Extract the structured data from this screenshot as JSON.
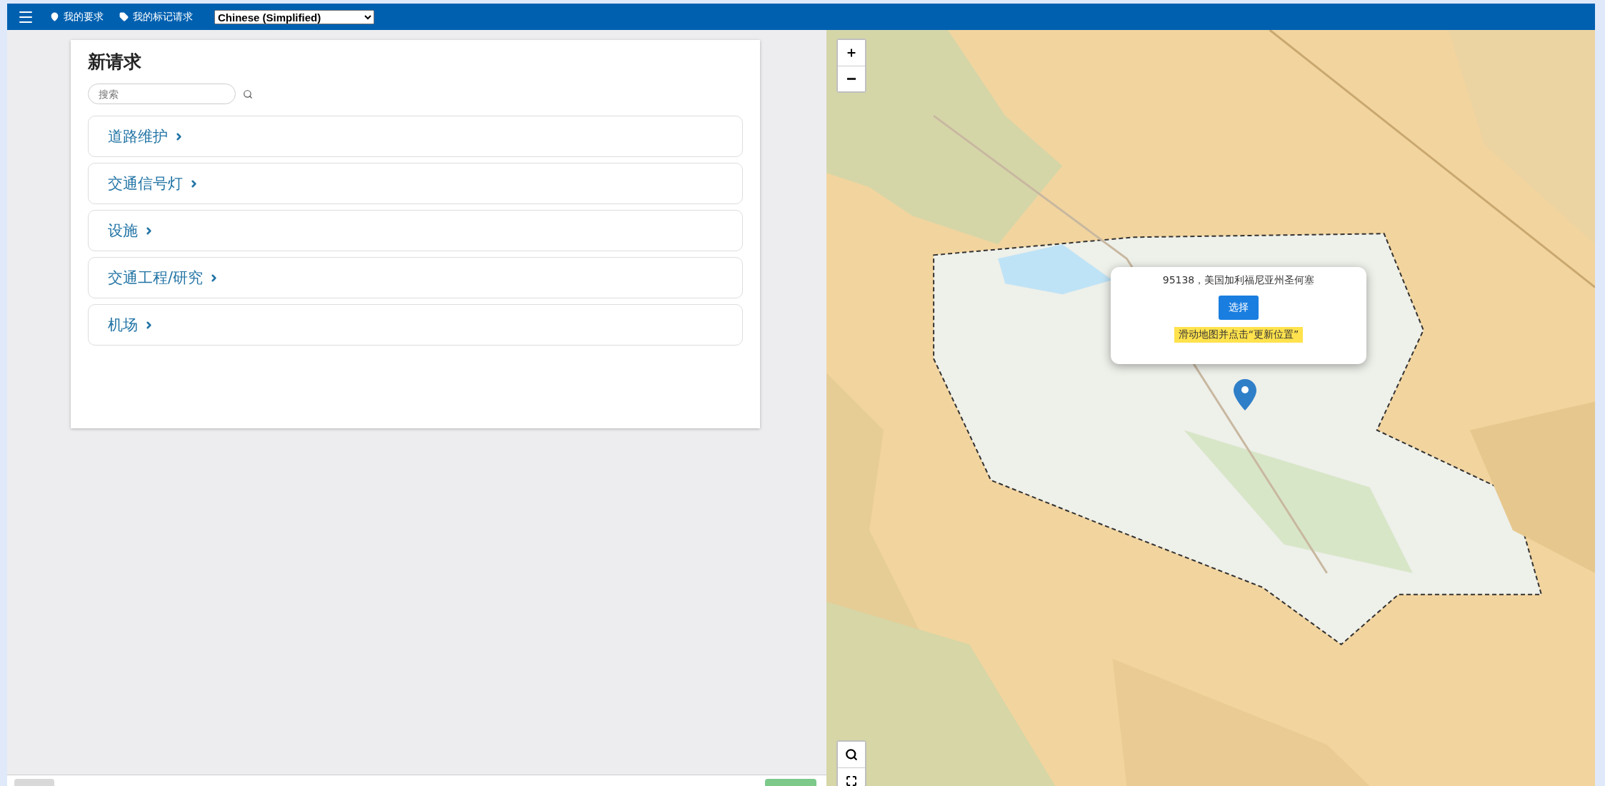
{
  "top_bar": {
    "links": [
      {
        "kind": "pin",
        "label": "我的要求"
      },
      {
        "kind": "tag",
        "label": "我的标记请求"
      }
    ],
    "language": "Chinese (Simplified)"
  },
  "panel": {
    "title": "新请求",
    "search": {
      "placeholder": "搜索"
    },
    "categories": [
      "道路维护",
      "交通信号灯",
      "设施",
      "交通工程/研究",
      "机场"
    ]
  },
  "map": {
    "popup": {
      "address": "95138，美国加利福尼亚州圣何塞",
      "button": "选择",
      "hint": "滑动地图并点击“更新位置”"
    }
  }
}
